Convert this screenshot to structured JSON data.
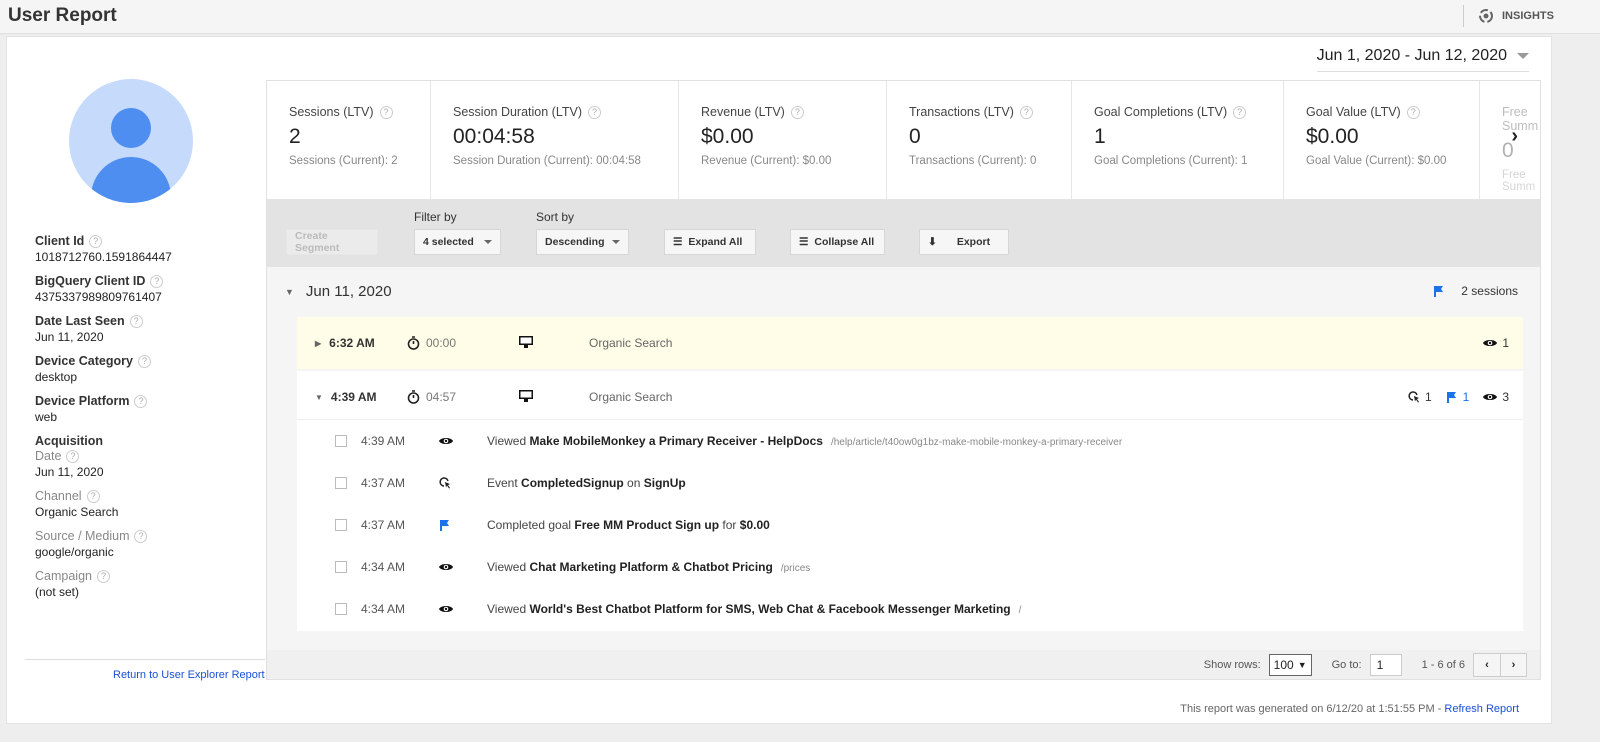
{
  "header": {
    "title": "User Report",
    "insights_label": "INSIGHTS"
  },
  "date_range": "Jun 1, 2020 - Jun 12, 2020",
  "user": {
    "fields": [
      {
        "label": "Client Id",
        "value": "1018712760.1591864447"
      },
      {
        "label": "BigQuery Client ID",
        "value": "4375337989809761407"
      },
      {
        "label": "Date Last Seen",
        "value": "Jun 11, 2020"
      },
      {
        "label": "Device Category",
        "value": "desktop"
      },
      {
        "label": "Device Platform",
        "value": "web"
      }
    ],
    "acquisition_title": "Acquisition",
    "acquisition": [
      {
        "label": "Date",
        "value": "Jun 11, 2020"
      },
      {
        "label": "Channel",
        "value": "Organic Search"
      },
      {
        "label": "Source / Medium",
        "value": "google/organic"
      },
      {
        "label": "Campaign",
        "value": "(not set)"
      }
    ],
    "return_link": "Return to User Explorer Report"
  },
  "metrics": [
    {
      "label": "Sessions (LTV)",
      "value": "2",
      "sub": "Sessions (Current): 2"
    },
    {
      "label": "Session Duration (LTV)",
      "value": "00:04:58",
      "sub": "Session Duration (Current): 00:04:58"
    },
    {
      "label": "Revenue (LTV)",
      "value": "$0.00",
      "sub": "Revenue (Current): $0.00"
    },
    {
      "label": "Transactions (LTV)",
      "value": "0",
      "sub": "Transactions (Current): 0"
    },
    {
      "label": "Goal Completions (LTV)",
      "value": "1",
      "sub": "Goal Completions (Current): 1"
    },
    {
      "label": "Goal Value (LTV)",
      "value": "$0.00",
      "sub": "Goal Value (Current): $0.00"
    },
    {
      "label": "Free Summ",
      "value": "0",
      "sub": "Free Summ"
    }
  ],
  "toolbar": {
    "create_segment": "Create Segment",
    "filter_label": "Filter by",
    "filter_value": "4 selected",
    "sort_label": "Sort by",
    "sort_value": "Descending",
    "expand_all": "Expand All",
    "collapse_all": "Collapse All",
    "export": "Export"
  },
  "timeline": {
    "date": "Jun 11, 2020",
    "sessions_count": "2 sessions",
    "sessions": [
      {
        "time": "6:32 AM",
        "duration": "00:00",
        "channel": "Organic Search",
        "views": "1",
        "highlighted": true
      },
      {
        "time": "4:39 AM",
        "duration": "04:57",
        "channel": "Organic Search",
        "events": "1",
        "goals": "1",
        "views": "3",
        "expanded": true
      }
    ],
    "hits": [
      {
        "time": "4:39 AM",
        "icon": "eye-icon",
        "prefix": "Viewed",
        "bold": "Make MobileMonkey a Primary Receiver - HelpDocs",
        "path": "/help/article/t40ow0g1bz-make-mobile-monkey-a-primary-receiver"
      },
      {
        "time": "4:37 AM",
        "icon": "event-click-icon",
        "prefix": "Event",
        "bold": "CompletedSignup",
        "mid": "on",
        "bold2": "SignUp"
      },
      {
        "time": "4:37 AM",
        "icon": "flag-icon",
        "prefix": "Completed goal",
        "bold": "Free MM Product Sign up",
        "mid": "for",
        "bold2": "$0.00"
      },
      {
        "time": "4:34 AM",
        "icon": "eye-icon",
        "prefix": "Viewed",
        "bold": "Chat Marketing Platform & Chatbot Pricing",
        "path": "/prices"
      },
      {
        "time": "4:34 AM",
        "icon": "eye-icon",
        "prefix": "Viewed",
        "bold": "World's Best Chatbot Platform for SMS, Web Chat & Facebook Messenger Marketing",
        "path": "/"
      }
    ]
  },
  "pagination": {
    "show_rows_label": "Show rows:",
    "show_rows_value": "100",
    "goto_label": "Go to:",
    "goto_value": "1",
    "range": "1 - 6 of 6"
  },
  "footer": {
    "generated": "This report was generated on 6/12/20 at 1:51:55 PM - ",
    "refresh": "Refresh Report"
  },
  "colors": {
    "accent_blue": "#1a73e8",
    "highlight_row": "#fffde7",
    "link": "#1a4fd6"
  }
}
